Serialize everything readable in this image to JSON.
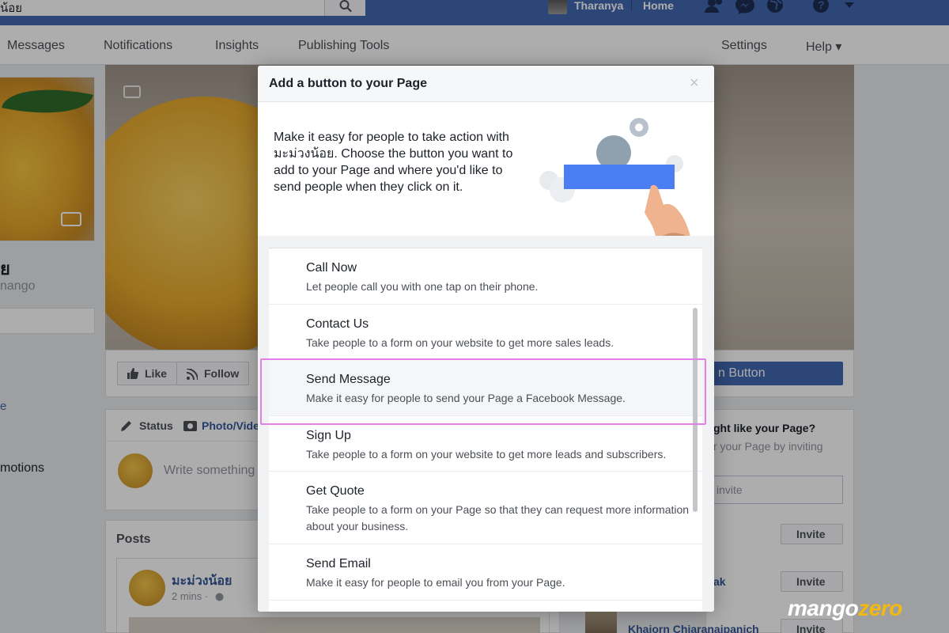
{
  "topbar": {
    "search_value": "น้อย",
    "user_name": "Tharanya",
    "home_label": "Home"
  },
  "tabs": {
    "items": [
      "Messages",
      "Notifications",
      "Insights",
      "Publishing Tools"
    ],
    "settings": "Settings",
    "help": "Help ▾"
  },
  "page": {
    "name": "ย",
    "handle": "nango",
    "left_link": "e",
    "promotions": "motions"
  },
  "cover_actions": {
    "like": "Like",
    "follow": "Follow",
    "add_button": "n Button"
  },
  "composer": {
    "status": "Status",
    "photo": "Photo/Vide",
    "placeholder": "Write something"
  },
  "posts": {
    "title": "Posts",
    "author": "มะม่วงน้อย",
    "time": "2 mins ·"
  },
  "right_panel": {
    "title": "ght like your Page?",
    "subtitle": "r your Page by inviting",
    "input_placeholder": "invite",
    "invite_label": "Invite",
    "friend1": "ak",
    "friend2": "Khaiorn Chiaranaipanich"
  },
  "modal": {
    "title": "Add a button to your Page",
    "close": "×",
    "intro": "Make it easy for people to take action with มะม่วงน้อย. Choose the button you want to add to your Page and where you'd like to send people when they click on it.",
    "options": [
      {
        "title": "Call Now",
        "desc": "Let people call you with one tap on their phone."
      },
      {
        "title": "Contact Us",
        "desc": "Take people to a form on your website to get more sales leads."
      },
      {
        "title": "Send Message",
        "desc": "Make it easy for people to send your Page a Facebook Message."
      },
      {
        "title": "Sign Up",
        "desc": "Take people to a form on your website to get more leads and subscribers."
      },
      {
        "title": "Get Quote",
        "desc": "Take people to a form on your Page so that they can request more information about your business."
      },
      {
        "title": "Send Email",
        "desc": "Make it easy for people to email you from your Page."
      }
    ],
    "selected_index": 2
  },
  "watermark": {
    "main": "mango",
    "accent": "zero"
  },
  "colors": {
    "facebook_blue": "#4267b2",
    "highlight": "#e67ee8",
    "illustration_button": "#4a7ef2"
  }
}
